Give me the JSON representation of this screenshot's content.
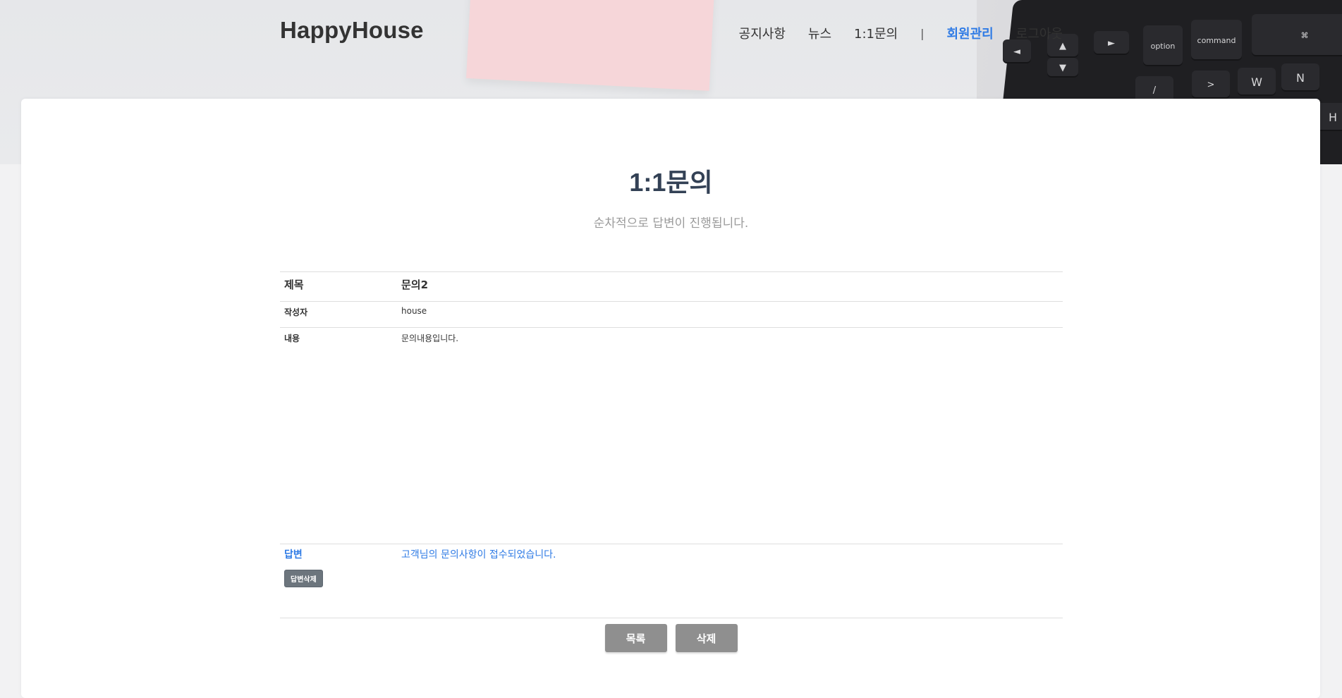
{
  "header": {
    "brand": "HappyHouse",
    "nav": [
      "공지사항",
      "뉴스",
      "1:1문의",
      "|",
      "회원관리",
      "로그아웃"
    ]
  },
  "hero": {
    "keys": [
      "◄",
      "▲",
      "▼",
      "►",
      "option",
      "command",
      "⌘",
      "/",
      ">",
      "W",
      "N",
      "H"
    ]
  },
  "page": {
    "title": "1:1문의",
    "subtitle": "순차적으로 답변이 진행됩니다."
  },
  "detail": {
    "title_label": "제목",
    "title_value": "문의2",
    "author_label": "작성자",
    "author_value": "house",
    "content_label": "내용",
    "content_value": "문의내용입니다.",
    "answer_label": "답변",
    "answer_value": "고객님의 문의사항이 접수되었습니다.",
    "answer_delete_button": "답변삭제"
  },
  "buttons": {
    "list": "목록",
    "delete": "삭제"
  },
  "colors": {
    "accent": "#2f7be5",
    "title": "#334155",
    "button_gray": "#8f8f8f",
    "button_dark": "#6c757d"
  }
}
